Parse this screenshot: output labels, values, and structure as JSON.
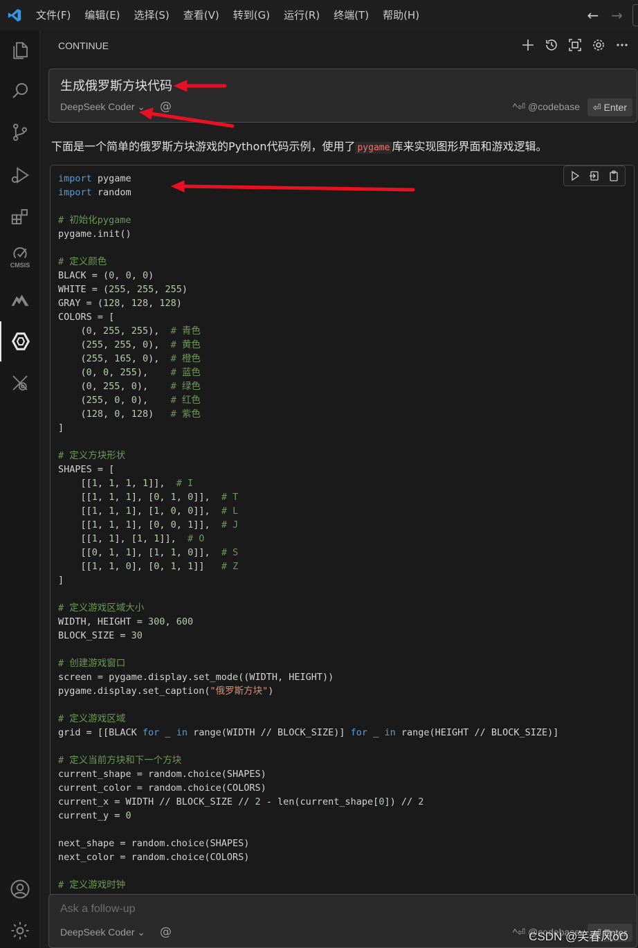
{
  "menu": [
    "文件(F)",
    "编辑(E)",
    "选择(S)",
    "查看(V)",
    "转到(G)",
    "运行(R)",
    "终端(T)",
    "帮助(H)"
  ],
  "activity": {
    "cmsis_label": "CMSIS"
  },
  "panel": {
    "title": "CONTINUE",
    "icons": [
      "plus-icon",
      "history-icon",
      "fullscreen-icon",
      "gear-icon",
      "more-icon"
    ]
  },
  "prompt": {
    "text": "生成俄罗斯方块代码",
    "model": "DeepSeek Coder",
    "at": "@",
    "codebase_hint": "^⏎ @codebase",
    "enter_label": "⏎ Enter"
  },
  "answer": {
    "intro_before": "下面是一个简单的俄罗斯方块游戏的Python代码示例，使用了",
    "intro_code": "pygame",
    "intro_after": "库来实现图形界面和游戏逻辑。"
  },
  "code_lines": [
    "import pygame",
    "import random",
    "",
    "# 初始化pygame",
    "pygame.init()",
    "",
    "# 定义颜色",
    "BLACK = (0, 0, 0)",
    "WHITE = (255, 255, 255)",
    "GRAY = (128, 128, 128)",
    "COLORS = [",
    "    (0, 255, 255),  # 青色",
    "    (255, 255, 0),  # 黄色",
    "    (255, 165, 0),  # 橙色",
    "    (0, 0, 255),    # 蓝色",
    "    (0, 255, 0),    # 绿色",
    "    (255, 0, 0),    # 红色",
    "    (128, 0, 128)   # 紫色",
    "]",
    "",
    "# 定义方块形状",
    "SHAPES = [",
    "    [[1, 1, 1, 1]],  # I",
    "    [[1, 1, 1], [0, 1, 0]],  # T",
    "    [[1, 1, 1], [1, 0, 0]],  # L",
    "    [[1, 1, 1], [0, 0, 1]],  # J",
    "    [[1, 1], [1, 1]],  # O",
    "    [[0, 1, 1], [1, 1, 0]],  # S",
    "    [[1, 1, 0], [0, 1, 1]]   # Z",
    "]",
    "",
    "# 定义游戏区域大小",
    "WIDTH, HEIGHT = 300, 600",
    "BLOCK_SIZE = 30",
    "",
    "# 创建游戏窗口",
    "screen = pygame.display.set_mode((WIDTH, HEIGHT))",
    "pygame.display.set_caption(\"俄罗斯方块\")",
    "",
    "# 定义游戏区域",
    "grid = [[BLACK for _ in range(WIDTH // BLOCK_SIZE)] for _ in range(HEIGHT // BLOCK_SIZE)]",
    "",
    "# 定义当前方块和下一个方块",
    "current_shape = random.choice(SHAPES)",
    "current_color = random.choice(COLORS)",
    "current_x = WIDTH // BLOCK_SIZE // 2 - len(current_shape[0]) // 2",
    "current_y = 0",
    "",
    "next_shape = random.choice(SHAPES)",
    "next_color = random.choice(COLORS)",
    "",
    "# 定义游戏时钟"
  ],
  "followup": {
    "placeholder": "Ask a follow-up",
    "model": "DeepSeek Coder",
    "at": "@",
    "codebase_hint": "^⏎ @codebase",
    "enter_label": "⏎ Enter"
  },
  "watermark": "CSDN @笑春风oO",
  "colors": {
    "accent": "#0078d4",
    "annotation": "#e81123"
  }
}
